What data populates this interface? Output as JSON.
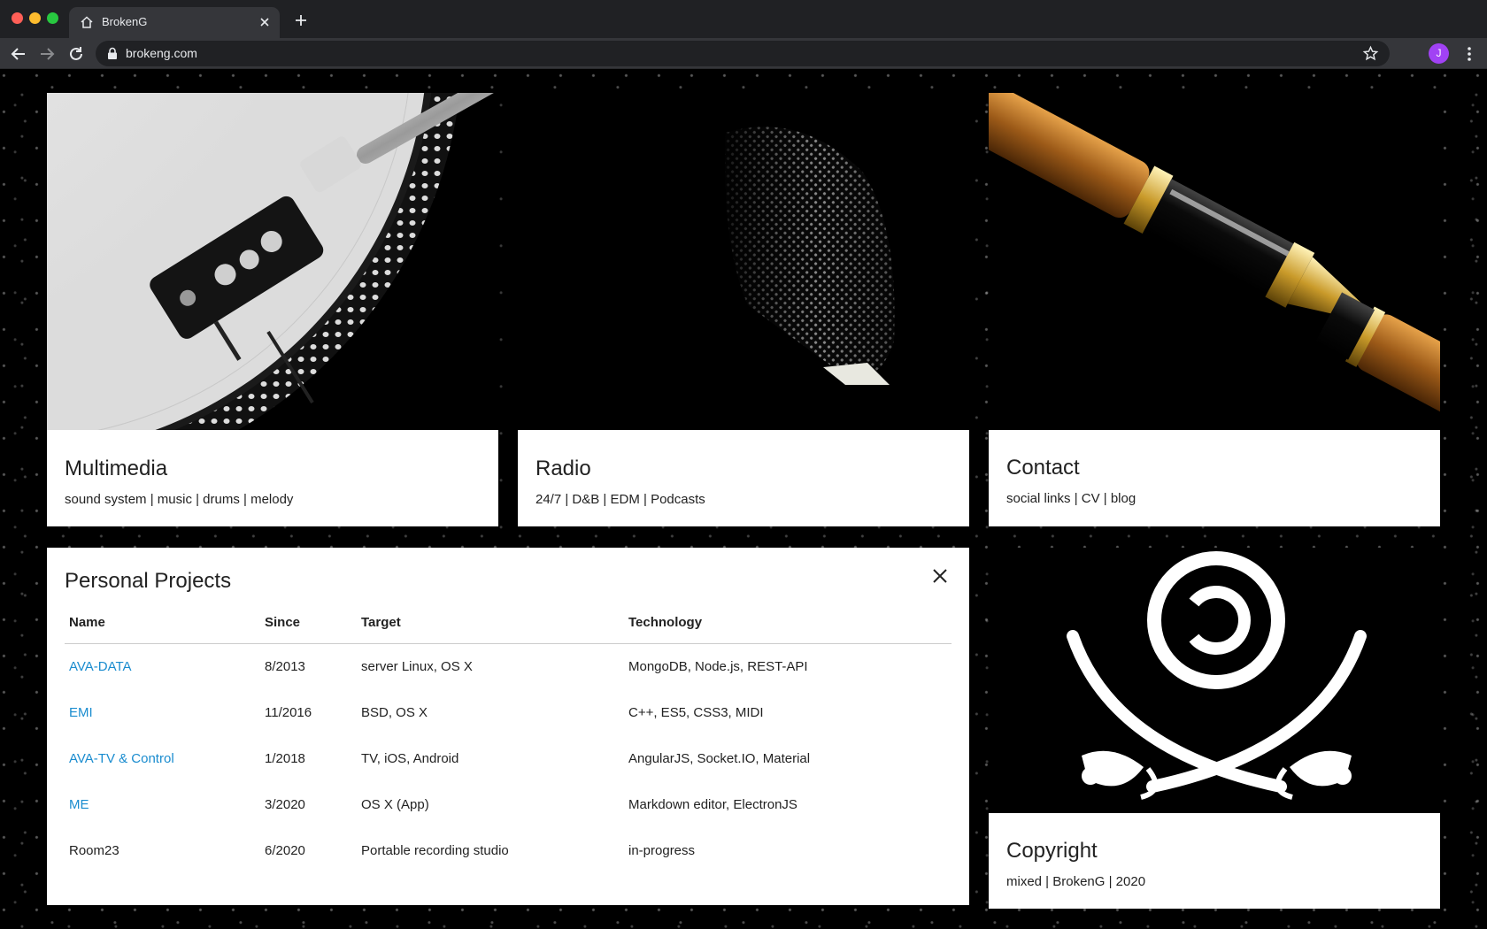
{
  "browser": {
    "tab_title": "BrokenG",
    "url": "brokeng.com",
    "avatar_letter": "J"
  },
  "cards": {
    "multimedia": {
      "title": "Multimedia",
      "subtitle": "sound system | music | drums | melody"
    },
    "radio": {
      "title": "Radio",
      "subtitle": "24/7 | D&B | EDM | Podcasts"
    },
    "contact": {
      "title": "Contact",
      "subtitle": "social links | CV | blog"
    },
    "copyright": {
      "title": "Copyright",
      "subtitle": "mixed | BrokenG | 2020"
    }
  },
  "projects": {
    "title": "Personal Projects",
    "columns": [
      "Name",
      "Since",
      "Target",
      "Technology"
    ],
    "rows": [
      {
        "name": "AVA-DATA",
        "since": "8/2013",
        "target": "server Linux, OS X",
        "technology": "MongoDB, Node.js, REST-API"
      },
      {
        "name": "EMI",
        "since": "11/2016",
        "target": "BSD, OS X",
        "technology": "C++, ES5, CSS3, MIDI"
      },
      {
        "name": "AVA-TV & Control",
        "since": "1/2018",
        "target": "TV, iOS, Android",
        "technology": "AngularJS, Socket.IO, Material"
      },
      {
        "name": "ME",
        "since": "3/2020",
        "target": "OS X (App)",
        "technology": "Markdown editor, ElectronJS"
      },
      {
        "name": "Room23",
        "since": "6/2020",
        "target": "Portable recording studio",
        "technology": "in-progress"
      }
    ]
  },
  "colors": {
    "link": "#1a8ccf",
    "avatar": "#a142f4"
  }
}
